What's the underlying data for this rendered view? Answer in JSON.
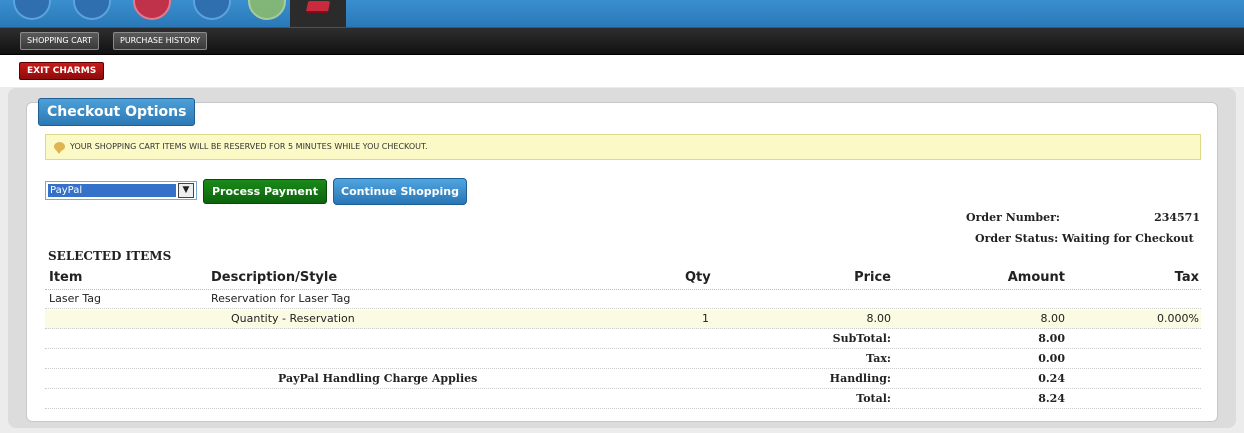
{
  "nav": {
    "tabs": [
      "SHOPPING CART",
      "PURCHASE HISTORY"
    ],
    "exit_label": "EXIT CHARMS"
  },
  "panel": {
    "title": "Checkout Options",
    "notice": "YOUR SHOPPING CART ITEMS WILL BE RESERVED FOR 5 MINUTES WHILE YOU CHECKOUT.",
    "payment_select": {
      "value": "PayPal"
    },
    "process_button": "Process Payment",
    "continue_button": "Continue Shopping"
  },
  "order": {
    "number_label": "Order Number:",
    "number_value": "234571",
    "status_text": "Order Status: Waiting for Checkout"
  },
  "items": {
    "section_title": "SELECTED ITEMS",
    "headers": [
      "Item",
      "Description/Style",
      "Qty",
      "Price",
      "Amount",
      "Tax"
    ],
    "rows": [
      {
        "item": "Laser Tag",
        "description": "Reservation for Laser Tag",
        "qty": "",
        "price": "",
        "amount": "",
        "tax": ""
      },
      {
        "item": "",
        "description": "Quantity - Reservation",
        "qty": "1",
        "price": "8.00",
        "amount": "8.00",
        "tax": "0.000%"
      }
    ],
    "totals": [
      {
        "note": "",
        "label": "SubTotal:",
        "value": "8.00"
      },
      {
        "note": "",
        "label": "Tax:",
        "value": "0.00"
      },
      {
        "note": "PayPal Handling Charge Applies",
        "label": "Handling:",
        "value": "0.24"
      },
      {
        "note": "",
        "label": "Total:",
        "value": "8.24"
      }
    ]
  },
  "colors": {
    "topbar": "#2a78b8",
    "process_button": "#0c640c",
    "continue_button": "#2a76b6",
    "exit_button": "#8e0b0b",
    "notice_bg": "#fbfac6"
  }
}
